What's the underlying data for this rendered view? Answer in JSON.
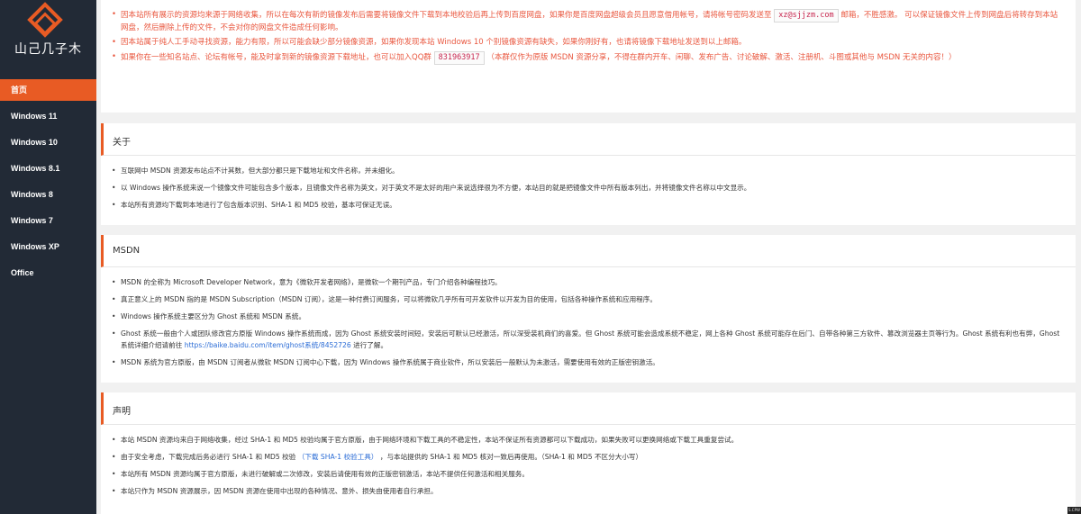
{
  "brand": {
    "logo_text": "山己几子木",
    "accent_color": "#e85b24",
    "sidebar_bg": "#222a36"
  },
  "sidebar": {
    "items": [
      {
        "label": "首页",
        "active": true
      },
      {
        "label": "Windows 11"
      },
      {
        "label": "Windows 10"
      },
      {
        "label": "Windows 8.1"
      },
      {
        "label": "Windows 8"
      },
      {
        "label": "Windows 7"
      },
      {
        "label": "Windows XP"
      },
      {
        "label": "Office"
      }
    ]
  },
  "notice": {
    "line1_a": "因本站所有展示的资源均来源于网络收集，所以在每次有新的镜像发布后需要将镜像文件下载到本地校验后再上传到百度网盘，如果你是百度网盘超级会员且愿意借用帐号，请将帐号密码发送至",
    "email": "xz@sjjzm.com",
    "line1_b": "邮箱，不胜感激。",
    "line1_c": "可以保证镜像文件上传到网盘后将转存到本站网盘，然后删除上传的文件，不会对你的网盘文件造成任何影响。",
    "line2": "因本站属于纯人工手动寻找资源，能力有限，所以可能会缺少部分镜像资源，如果你发现本站 Windows 10 个别镜像资源有缺失，如果你刚好有，也请将镜像下载地址发送到以上邮箱。",
    "line3_a": "如果你在一些知名站点、论坛有帐号，能及时拿到新的镜像资源下载地址，也可以加入QQ群",
    "qq": "831963917",
    "line3_b": "（本群仅作为原版 MSDN 资源分享，不得在群内开车、闲聊、发布广告、讨论破解、激活、注册机、斗图或其他与 MSDN 无关的内容！）"
  },
  "about": {
    "title": "关于",
    "items": [
      "互联网中 MSDN 资源发布站点不计其数，但大部分都只是下载地址和文件名称，并未细化。",
      "以 Windows 操作系统来说一个镜像文件可能包含多个版本，且镜像文件名称为英文，对于英文不是太好的用户来说选择很为不方便，本站目的就是把镜像文件中所有版本列出，并将镜像文件名称以中文显示。",
      "本站所有资源均下载到本地进行了包含版本识别、SHA-1 和 MD5 校验，基本可保证无误。"
    ]
  },
  "msdn": {
    "title": "MSDN",
    "items": [
      "MSDN 的全称为 Microsoft Developer Network，意为《微软开发者网络》，是微软一个期刊产品，专门介绍各种编程技巧。",
      "真正意义上的 MSDN 指的是 MSDN Subscription（MSDN 订阅），这是一种付费订阅服务，可以将微软几乎所有可开发软件以开发为目的使用，包括各种操作系统和应用程序。",
      "Windows 操作系统主要区分为 Ghost 系统和 MSDN 系统。"
    ],
    "ghost_a": "Ghost 系统一般由个人或团队修改官方原版 Windows 操作系统而成，因为 Ghost 系统安装时间短，安装后可默认已经激活，所以深受装机商们的喜爱。但 Ghost 系统可能会造成系统不稳定，网上各种 Ghost 系统可能存在后门、自带各种第三方软件、篡改浏览器主页等行为。Ghost 系统有利也有弊，Ghost 系统详细介绍请前往",
    "ghost_link": "https://baike.baidu.com/item/ghost系统/8452726",
    "ghost_b": "进行了解。",
    "last": "MSDN 系统为官方原版，由 MSDN 订阅者从微软 MSDN 订阅中心下载，因为 Windows 操作系统属于商业软件，所以安装后一般默认为未激活，需要使用有效的正版密钥激活。"
  },
  "statement": {
    "title": "声明",
    "item1": "本站 MSDN 资源均来自于网络收集，经过 SHA-1 和 MD5 校验均属于官方原版，由于网络环境和下载工具的不稳定性，本站不保证所有资源都可以下载成功，如果失败可以更换网络或下载工具重复尝试。",
    "item2_a": "由于安全考虑，下载完成后务必进行 SHA-1 和 MD5 校验",
    "item2_link": "（下载 SHA-1 校验工具）",
    "item2_b": "，与本站提供的 SHA-1 和 MD5 核对一致后再使用。（SHA-1 和 MD5 不区分大小写）",
    "item3": "本站所有 MSDN 资源均属于官方原版，未进行破解或二次修改，安装后请使用有效的正版密钥激活，本站不提供任何激活和相关服务。",
    "item4": "本站只作为 MSDN 资源展示，因 MSDN 资源在使用中出现的各种情况、意外、损失由使用者自行承担。"
  },
  "badge": "S.CPW"
}
